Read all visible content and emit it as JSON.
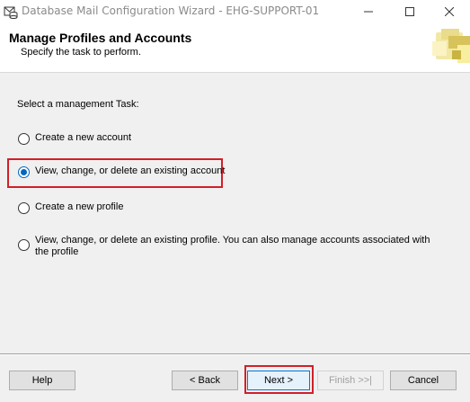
{
  "window": {
    "title": "Database Mail Configuration Wizard - EHG-SUPPORT-01",
    "icon": "database-mail-icon"
  },
  "header": {
    "title": "Manage Profiles and Accounts",
    "subtitle": "Specify the task to perform."
  },
  "main": {
    "task_label": "Select a management Task:",
    "options": [
      {
        "label": "Create a new account",
        "selected": false
      },
      {
        "label": "View, change, or delete an existing account",
        "selected": true
      },
      {
        "label": "Create a new profile",
        "selected": false
      },
      {
        "label": "View, change, or delete an existing profile. You can also manage accounts associated with the profile",
        "selected": false
      }
    ]
  },
  "buttons": {
    "help": "Help",
    "back": "< Back",
    "next": "Next >",
    "finish": "Finish >>|",
    "cancel": "Cancel"
  },
  "colors": {
    "highlight": "#d21f28",
    "radio_accent": "#0067c0"
  }
}
